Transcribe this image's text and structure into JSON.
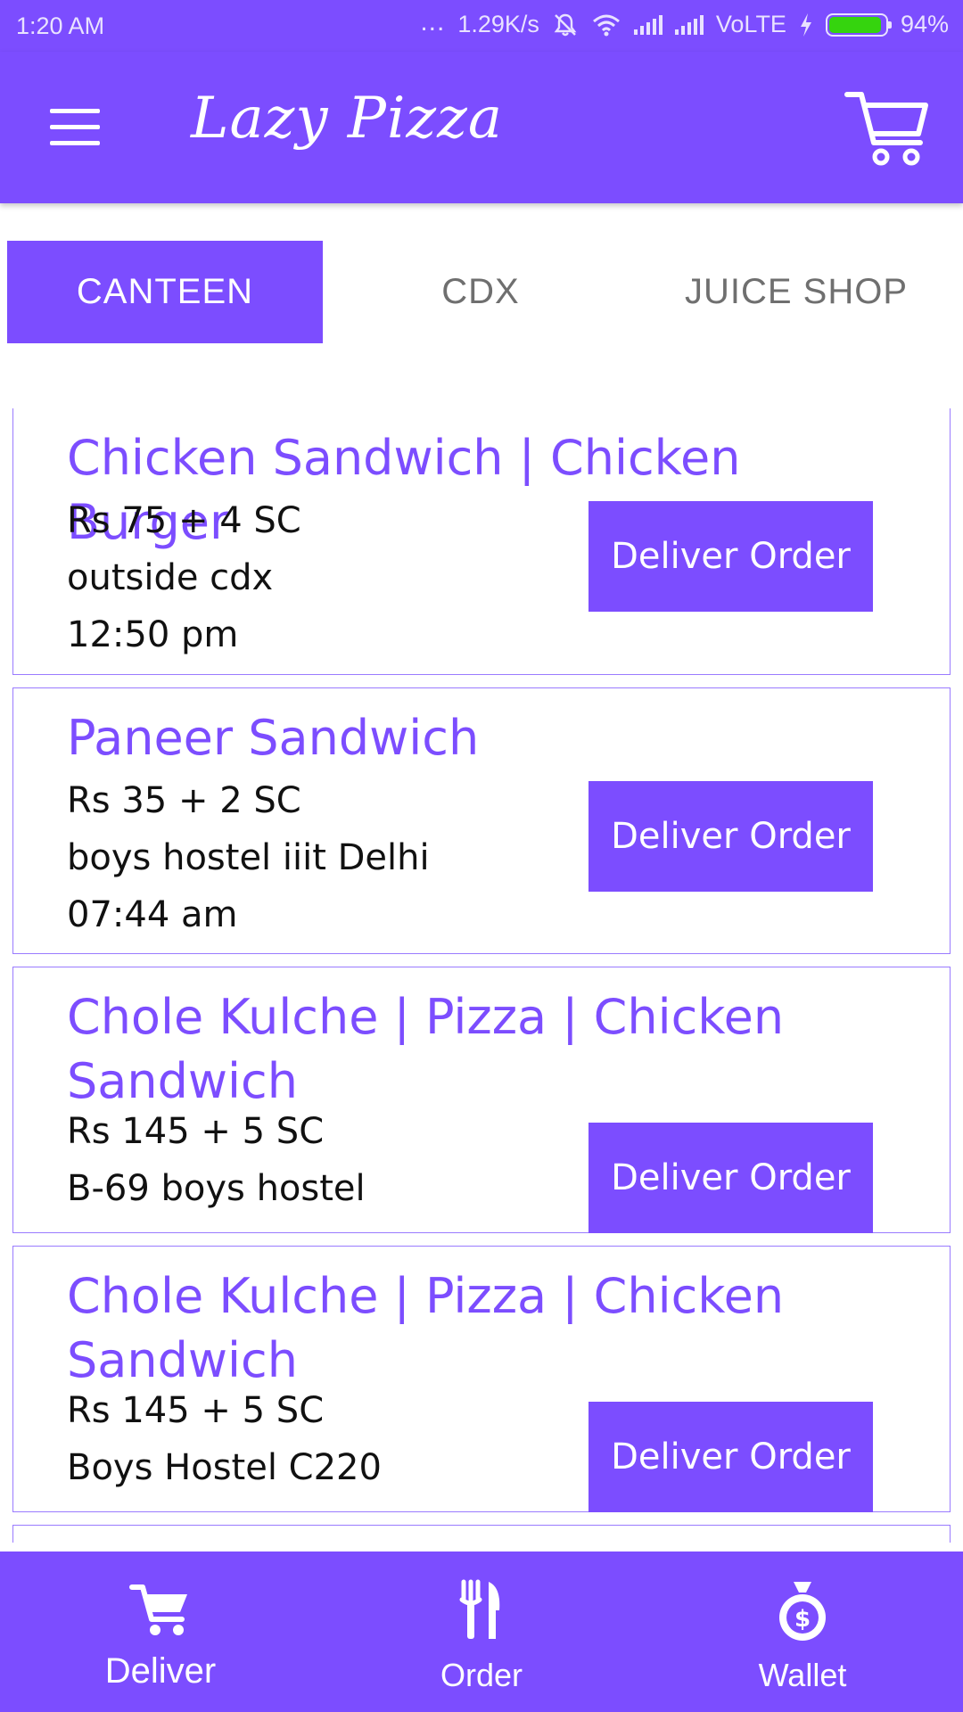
{
  "status_bar": {
    "time": "1:20 AM",
    "dots": "...",
    "speed": "1.29K/s",
    "network": "VoLTE",
    "battery": "94%"
  },
  "app_bar": {
    "title": "Lazy Pizza",
    "menu_icon": "hamburger-menu-icon",
    "cart_icon": "cart-icon"
  },
  "tabs": [
    {
      "label": "CANTEEN",
      "active": true
    },
    {
      "label": "CDX",
      "active": false
    },
    {
      "label": "JUICE SHOP",
      "active": false
    }
  ],
  "orders": [
    {
      "title": "Chicken Sandwich | Chicken Burger",
      "price": "Rs 75 + 4 SC",
      "location": "outside cdx",
      "time": "12:50 pm",
      "button": "Deliver Order"
    },
    {
      "title": "Paneer Sandwich",
      "price": "Rs 35 + 2 SC",
      "location": "boys hostel iiit Delhi",
      "time": "07:44 am",
      "button": "Deliver Order"
    },
    {
      "title": "Chole Kulche | Pizza | Chicken Sandwich",
      "price": "Rs 145 + 5 SC",
      "location": "B-69 boys hostel",
      "button": "Deliver Order"
    },
    {
      "title": "Chole Kulche | Pizza | Chicken Sandwich",
      "price": "Rs 145 + 5 SC",
      "location": "Boys Hostel C220",
      "button": "Deliver Order"
    }
  ],
  "bottom_nav": [
    {
      "label": "Deliver",
      "icon": "cart-icon",
      "active": true
    },
    {
      "label": "Order",
      "icon": "fork-knife-icon",
      "active": false
    },
    {
      "label": "Wallet",
      "icon": "money-bag-icon",
      "active": false
    }
  ],
  "colors": {
    "primary": "#7c4dff",
    "text": "#111111",
    "tab_inactive": "#6f6f6f"
  }
}
